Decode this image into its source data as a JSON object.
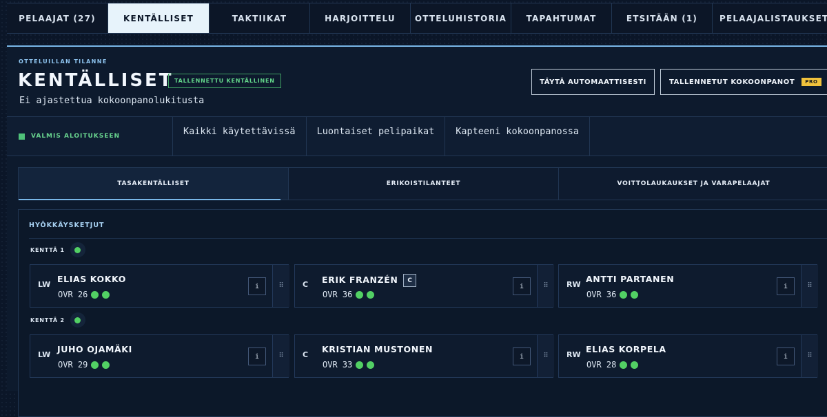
{
  "nav": {
    "tabs": [
      {
        "label": "PELAAJAT (27)",
        "active": false
      },
      {
        "label": "KENTÄLLISET",
        "active": true
      },
      {
        "label": "TAKTIIKAT",
        "active": false
      },
      {
        "label": "HARJOITTELU",
        "active": false
      },
      {
        "label": "OTTELUHISTORIA",
        "active": false
      },
      {
        "label": "TAPAHTUMAT",
        "active": false
      },
      {
        "label": "ETSITÄÄN (1)",
        "active": false
      },
      {
        "label": "PELAAJALISTAUKSET",
        "active": false
      }
    ]
  },
  "header": {
    "eyebrow": "OTTELUILLAN TILANNE",
    "title": "KENTÄLLISET",
    "saved_badge": "TALLENNETTU KENTÄLLINEN",
    "subtitle": "Ei ajastettua kokoonpanolukitusta",
    "auto_fill_button": "TÄYTÄ AUTOMAATTISESTI",
    "saved_lineups_button": "TALLENNETUT KOKOONPANOT",
    "pro_badge": "PRO"
  },
  "status": {
    "ready_label": "VALMIS ALOITUKSEEN",
    "ready_color": "#4fc27a",
    "chips": [
      "Kaikki käytettävissä",
      "Luontaiset pelipaikat",
      "Kapteeni kokoonpanossa"
    ]
  },
  "subtabs": [
    {
      "label": "TASAKENTÄLLISET",
      "active": true
    },
    {
      "label": "ERIKOISTILANTEET",
      "active": false
    },
    {
      "label": "VOITTOLAUKAUKSET JA VARAPELAAJAT",
      "active": false
    }
  ],
  "section": {
    "title": "HYÖKKÄYSKETJUT",
    "lines": [
      {
        "label": "KENTTÄ 1",
        "players": [
          {
            "pos": "LW",
            "name": "ELIAS KOKKO",
            "captain": false,
            "ovr_label": "OVR",
            "ovr": "26"
          },
          {
            "pos": "C",
            "name": "ERIK FRANZÉN",
            "captain": true,
            "captain_mark": "C",
            "ovr_label": "OVR",
            "ovr": "36"
          },
          {
            "pos": "RW",
            "name": "ANTTI PARTANEN",
            "captain": false,
            "ovr_label": "OVR",
            "ovr": "36"
          }
        ]
      },
      {
        "label": "KENTTÄ 2",
        "players": [
          {
            "pos": "LW",
            "name": "JUHO OJAMÄKI",
            "captain": false,
            "ovr_label": "OVR",
            "ovr": "29"
          },
          {
            "pos": "C",
            "name": "KRISTIAN MUSTONEN",
            "captain": false,
            "ovr_label": "OVR",
            "ovr": "33"
          },
          {
            "pos": "RW",
            "name": "ELIAS KORPELA",
            "captain": false,
            "ovr_label": "OVR",
            "ovr": "28"
          }
        ]
      }
    ],
    "info_glyph": "i",
    "drag_glyph": "⠿",
    "status_dot_color": "#52d064"
  }
}
